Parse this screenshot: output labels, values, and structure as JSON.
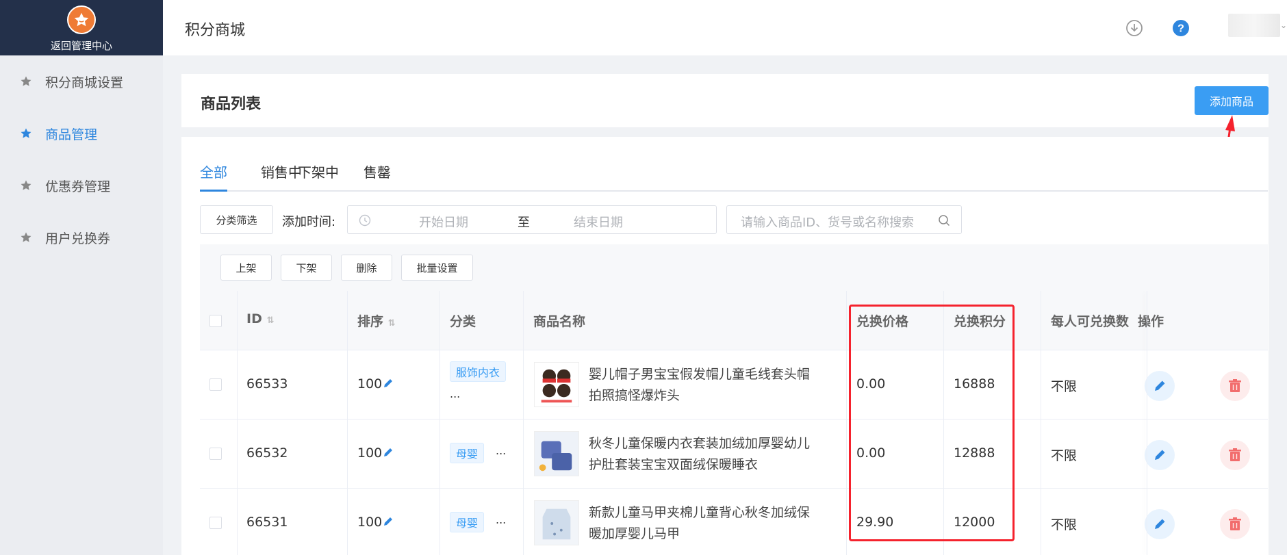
{
  "sidebar": {
    "back_label": "返回管理中心",
    "items": [
      {
        "label": "积分商城设置",
        "active": false
      },
      {
        "label": "商品管理",
        "active": true
      },
      {
        "label": "优惠券管理",
        "active": false
      },
      {
        "label": "用户兑换券",
        "active": false
      }
    ]
  },
  "header": {
    "title": "积分商城"
  },
  "list_card": {
    "title": "商品列表",
    "add_button": "添加商品"
  },
  "tabs": [
    {
      "label": "全部",
      "active": true
    },
    {
      "label": "销售中",
      "active": false
    },
    {
      "label": "下架中",
      "active": false
    },
    {
      "label": "售罄",
      "active": false
    }
  ],
  "filters": {
    "category_button": "分类筛选",
    "time_label": "添加时间:",
    "start_placeholder": "开始日期",
    "to_label": "至",
    "end_placeholder": "结束日期",
    "search_placeholder": "请输入商品ID、货号或名称搜索"
  },
  "bulk_actions": {
    "on_shelf": "上架",
    "off_shelf": "下架",
    "delete": "删除",
    "batch_settings": "批量设置"
  },
  "table": {
    "columns": {
      "id": "ID",
      "sort": "排序",
      "category": "分类",
      "name": "商品名称",
      "price": "兑换价格",
      "points": "兑换积分",
      "limit": "每人可兑换数",
      "ops": "操作"
    },
    "rows": [
      {
        "id": "66533",
        "sort": "100",
        "category": "服饰内衣",
        "more": "...",
        "name": "婴儿帽子男宝宝假发帽儿童毛线套头帽拍照搞怪爆炸头",
        "price": "0.00",
        "points": "16888",
        "limit": "不限"
      },
      {
        "id": "66532",
        "sort": "100",
        "category": "母婴",
        "more": "...",
        "name": "秋冬儿童保暖内衣套装加绒加厚婴幼儿护肚套装宝宝双面绒保暖睡衣",
        "price": "0.00",
        "points": "12888",
        "limit": "不限"
      },
      {
        "id": "66531",
        "sort": "100",
        "category": "母婴",
        "more": "...",
        "name": "新款儿童马甲夹棉儿童背心秋冬加绒保暖加厚婴儿马甲",
        "price": "29.90",
        "points": "12000",
        "limit": "不限"
      }
    ]
  },
  "colors": {
    "primary": "#3a9df3",
    "sidebar_top": "#23304a",
    "highlight": "#f5222d",
    "delete": "#f26d6d"
  }
}
